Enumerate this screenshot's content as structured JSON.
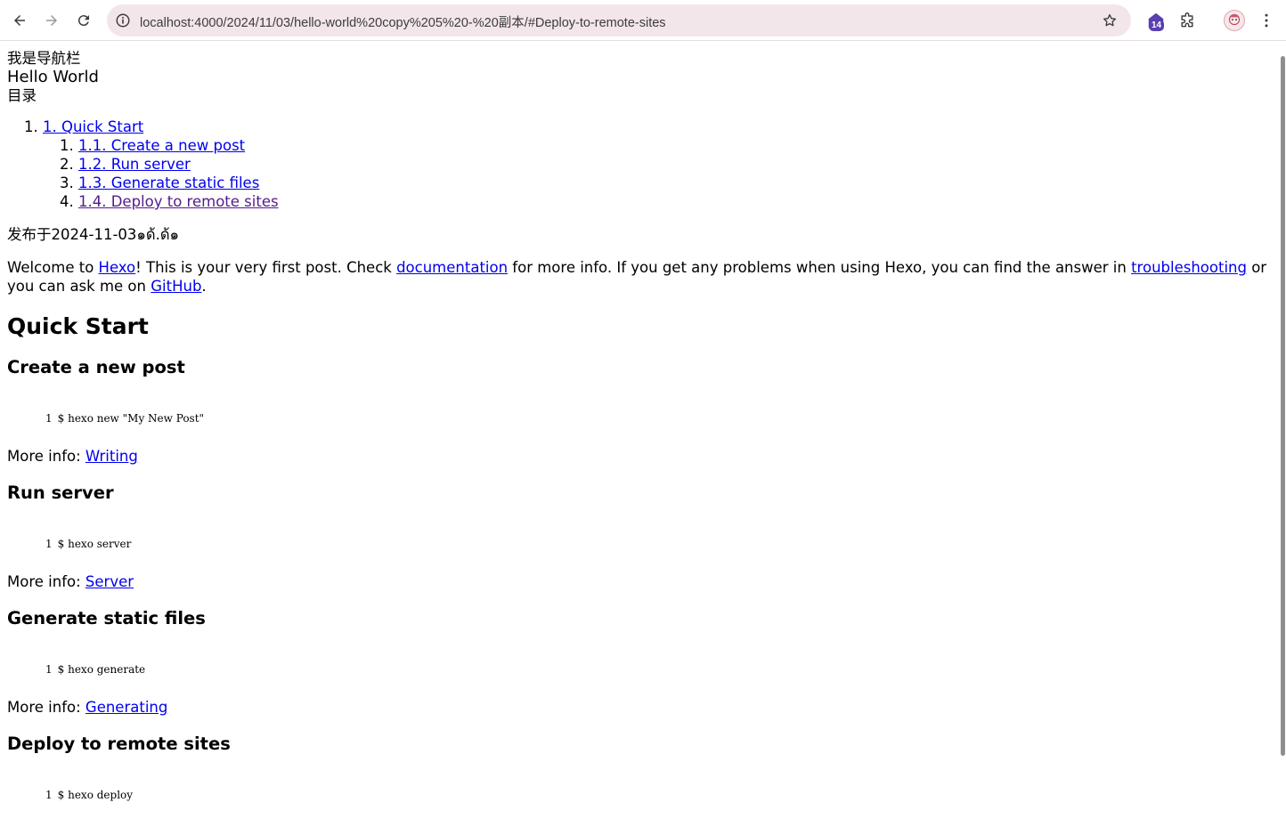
{
  "browser": {
    "url": "localhost:4000/2024/11/03/hello-world%20copy%205%20-%20副本/#Deploy-to-remote-sites",
    "extension_badge": "14"
  },
  "page": {
    "nav_text": "我是导航栏",
    "site_title": "Hello World",
    "toc_label": "目录",
    "toc": {
      "main": "1. Quick Start",
      "items": [
        "1.1. Create a new post",
        "1.2. Run server",
        "1.3. Generate static files",
        "1.4. Deploy to remote sites"
      ]
    },
    "published_prefix": "发布于",
    "published_date": "2024-11-03",
    "published_suffix": "๑ด้.ด้๑",
    "intro": {
      "t1": "Welcome to ",
      "link_hexo": "Hexo",
      "t2": "! This is your very first post. Check ",
      "link_docs": "documentation",
      "t3": " for more info. If you get any problems when using Hexo, you can find the answer in ",
      "link_trouble": "troubleshooting",
      "t4": " or you can ask me on ",
      "link_github": "GitHub",
      "t5": "."
    },
    "h_quick_start": "Quick Start",
    "sections": [
      {
        "title": "Create a new post",
        "line_no": "1",
        "code": "$ hexo new \"My New Post\"",
        "more_label": "More info: ",
        "more_link": "Writing"
      },
      {
        "title": "Run server",
        "line_no": "1",
        "code": "$ hexo server",
        "more_label": "More info: ",
        "more_link": "Server"
      },
      {
        "title": "Generate static files",
        "line_no": "1",
        "code": "$ hexo generate",
        "more_label": "More info: ",
        "more_link": "Generating"
      },
      {
        "title": "Deploy to remote sites",
        "line_no": "1",
        "code": "$ hexo deploy"
      }
    ]
  },
  "colors": {
    "link": "#0000ee",
    "visited_link": "#551a8b",
    "omnibox_bg": "#f3e6ea"
  },
  "icons": [
    "back-icon",
    "forward-icon",
    "reload-icon",
    "site-info-icon",
    "bookmark-star-icon",
    "extension-home-icon",
    "puzzle-icon",
    "kebab-menu-icon"
  ]
}
